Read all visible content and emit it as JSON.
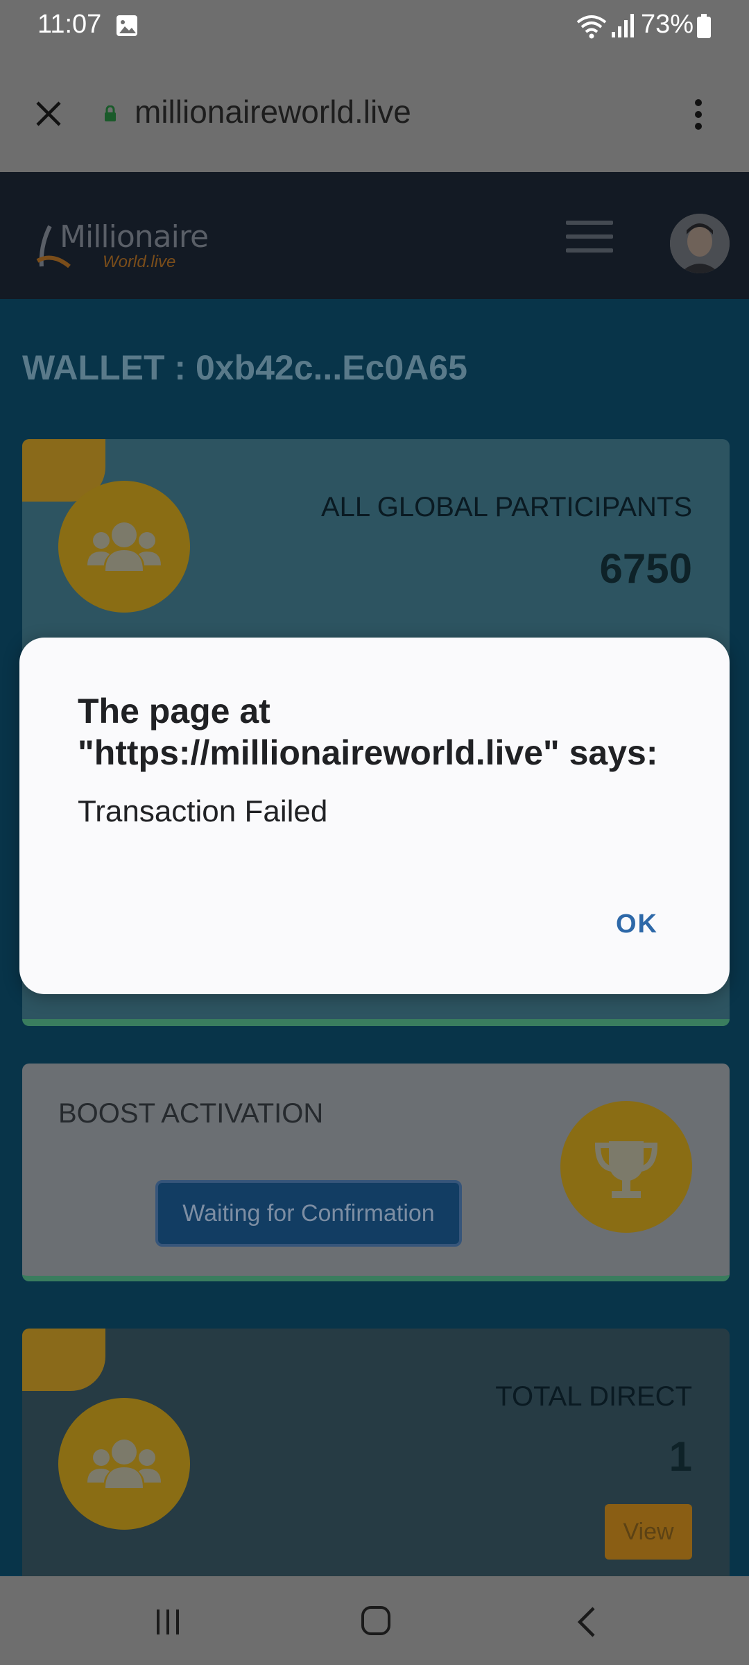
{
  "status_bar": {
    "time": "11:07",
    "battery": "73%"
  },
  "browser": {
    "url": "millionaireworld.live"
  },
  "site": {
    "logo_line1": "Millionaire",
    "logo_line2": "World.live"
  },
  "page": {
    "wallet": "WALLET : 0xb42c...Ec0A65",
    "cards": [
      {
        "title": "ALL GLOBAL PARTICIPANTS",
        "value": "6750"
      },
      {
        "title": "BOOST ACTIVATION",
        "button": "Waiting for Confirmation"
      },
      {
        "title": "TOTAL DIRECT",
        "value": "1",
        "button": "View"
      }
    ]
  },
  "dialog": {
    "heading": "The page at \"https://millionaireworld.live\" says:",
    "message": "Transaction Failed",
    "ok_label": "OK"
  },
  "colors": {
    "accent_orange": "#e59a00",
    "dialog_ok": "#2d68a8"
  }
}
